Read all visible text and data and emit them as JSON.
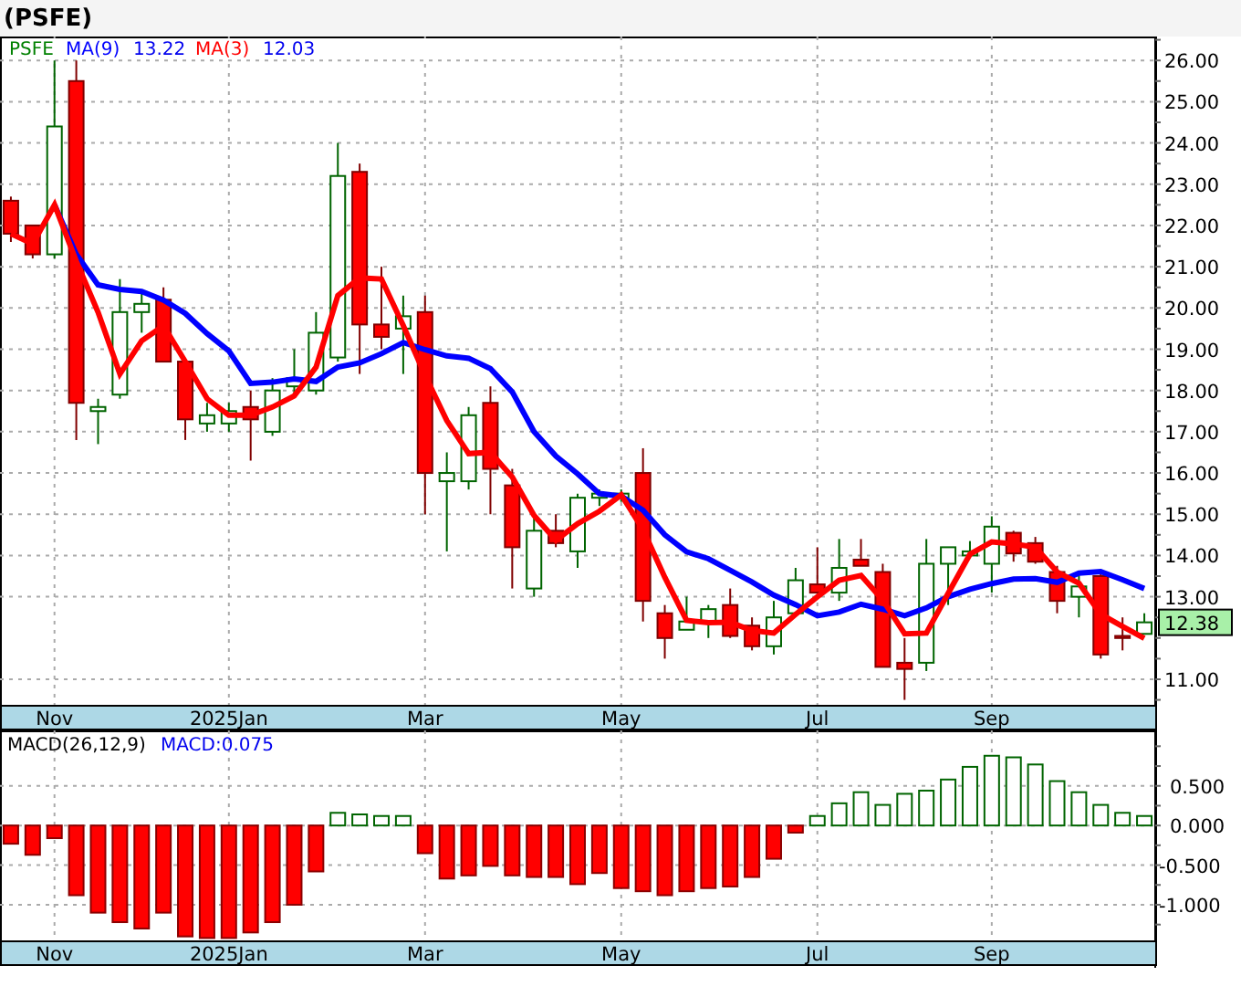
{
  "title": "(PSFE)",
  "price_panel": {
    "legend": {
      "symbol": "PSFE",
      "values": [
        "13.22",
        "12.03"
      ]
    },
    "last_price": "12.38",
    "chart_data": {
      "type": "candlestick",
      "grid": true,
      "ylim": [
        10.38,
        26.58
      ],
      "categories": [
        null,
        null,
        "Nov",
        null,
        null,
        null,
        null,
        null,
        null,
        null,
        "2025Jan",
        null,
        null,
        null,
        null,
        null,
        null,
        null,
        null,
        "Mar",
        null,
        null,
        null,
        null,
        null,
        null,
        null,
        null,
        "May",
        null,
        null,
        null,
        null,
        null,
        null,
        null,
        null,
        "Jul",
        null,
        null,
        null,
        null,
        null,
        null,
        null,
        "Sep",
        null,
        null,
        null,
        null,
        null,
        null,
        null
      ],
      "yticks": [
        {
          "value": 26,
          "label": "26.00"
        },
        {
          "value": 25,
          "label": "25.00"
        },
        {
          "value": 24,
          "label": "24.00"
        },
        {
          "value": 23,
          "label": "23.00"
        },
        {
          "value": 22,
          "label": "22.00"
        },
        {
          "value": 21,
          "label": "21.00"
        },
        {
          "value": 20,
          "label": "20.00"
        },
        {
          "value": 19,
          "label": "19.00"
        },
        {
          "value": 18,
          "label": "18.00"
        },
        {
          "value": 17,
          "label": "17.00"
        },
        {
          "value": 16,
          "label": "16.00"
        },
        {
          "value": 15,
          "label": "15.00"
        },
        {
          "value": 14,
          "label": "14.00"
        },
        {
          "value": 13,
          "label": "13.00"
        },
        {
          "value": 11,
          "label": "11.00"
        }
      ],
      "ohlc": [
        [
          22.6,
          22.7,
          21.6,
          21.8
        ],
        [
          22.0,
          22.0,
          21.2,
          21.3
        ],
        [
          21.3,
          26.0,
          21.2,
          24.4
        ],
        [
          25.5,
          26.0,
          16.8,
          17.7
        ],
        [
          17.5,
          17.8,
          16.7,
          17.6
        ],
        [
          17.9,
          20.7,
          17.8,
          19.9
        ],
        [
          19.9,
          20.4,
          19.4,
          20.1
        ],
        [
          20.2,
          20.5,
          18.7,
          18.7
        ],
        [
          18.7,
          18.7,
          16.8,
          17.3
        ],
        [
          17.2,
          17.7,
          17.0,
          17.4
        ],
        [
          17.2,
          17.7,
          17.0,
          17.5
        ],
        [
          17.6,
          18.0,
          16.3,
          17.3
        ],
        [
          17.0,
          18.3,
          16.9,
          18.0
        ],
        [
          18.1,
          19.0,
          17.9,
          18.3
        ],
        [
          18.0,
          19.9,
          17.9,
          19.4
        ],
        [
          18.8,
          24.0,
          18.7,
          23.2
        ],
        [
          23.3,
          23.5,
          18.4,
          19.6
        ],
        [
          19.6,
          21.0,
          19.0,
          19.3
        ],
        [
          19.5,
          20.3,
          18.4,
          19.8
        ],
        [
          19.9,
          20.3,
          15.0,
          16.0
        ],
        [
          15.8,
          16.5,
          14.1,
          16.0
        ],
        [
          15.8,
          17.6,
          15.6,
          17.4
        ],
        [
          17.7,
          18.1,
          15.0,
          16.1
        ],
        [
          15.7,
          16.1,
          13.2,
          14.2
        ],
        [
          13.2,
          15.0,
          13.0,
          14.6
        ],
        [
          14.6,
          15.0,
          14.2,
          14.3
        ],
        [
          14.1,
          15.5,
          13.7,
          15.4
        ],
        [
          15.4,
          15.6,
          15.2,
          15.5
        ],
        [
          15.4,
          15.6,
          15.3,
          15.5
        ],
        [
          16.0,
          16.6,
          12.4,
          12.9
        ],
        [
          12.6,
          12.8,
          11.5,
          12.0
        ],
        [
          12.2,
          13.0,
          12.2,
          12.4
        ],
        [
          12.4,
          12.8,
          12.0,
          12.7
        ],
        [
          12.8,
          13.2,
          12.0,
          12.05
        ],
        [
          12.3,
          12.5,
          11.7,
          11.8
        ],
        [
          11.8,
          12.9,
          11.6,
          12.5
        ],
        [
          12.6,
          13.7,
          12.6,
          13.4
        ],
        [
          13.3,
          14.2,
          13.1,
          13.1
        ],
        [
          13.1,
          14.4,
          12.9,
          13.7
        ],
        [
          13.9,
          14.4,
          13.75,
          13.75
        ],
        [
          13.6,
          13.8,
          11.3,
          11.3
        ],
        [
          11.4,
          12.0,
          10.5,
          11.25
        ],
        [
          11.4,
          14.4,
          11.2,
          13.8
        ],
        [
          13.8,
          14.2,
          12.8,
          14.2
        ],
        [
          14.0,
          14.35,
          14.0,
          14.1
        ],
        [
          13.8,
          14.95,
          13.1,
          14.7
        ],
        [
          14.55,
          14.6,
          13.85,
          14.05
        ],
        [
          14.3,
          14.45,
          13.8,
          13.85
        ],
        [
          13.6,
          13.75,
          12.6,
          12.9
        ],
        [
          13.0,
          13.6,
          12.5,
          13.25
        ],
        [
          13.5,
          13.55,
          11.5,
          11.6
        ],
        [
          12.05,
          12.5,
          11.7,
          12.0
        ],
        [
          12.1,
          12.6,
          12.1,
          12.38
        ]
      ],
      "series": [
        {
          "name": "MA(9)",
          "color": "#0000ff",
          "type": "line",
          "values": [
            null,
            null,
            22.5,
            21.3,
            20.56,
            20.45,
            20.4,
            20.19,
            19.87,
            19.38,
            18.96,
            18.17,
            18.2,
            18.28,
            18.22,
            18.57,
            18.67,
            18.89,
            19.16,
            18.99,
            18.84,
            18.78,
            18.53,
            17.96,
            17.0,
            16.41,
            15.98,
            15.5,
            15.44,
            15.1,
            14.5,
            14.09,
            13.92,
            13.64,
            13.36,
            13.04,
            12.81,
            12.54,
            12.63,
            12.82,
            12.7,
            12.54,
            12.73,
            13.0,
            13.18,
            13.32,
            13.43,
            13.44,
            13.35,
            13.57,
            13.61,
            13.41,
            13.2
          ]
        },
        {
          "name": "MA(3)",
          "color": "#ff0000",
          "type": "line",
          "values": [
            21.8,
            21.55,
            22.5,
            21.13,
            19.9,
            18.4,
            19.2,
            19.57,
            18.7,
            17.8,
            17.4,
            17.4,
            17.6,
            17.87,
            18.57,
            20.3,
            20.73,
            20.7,
            19.57,
            18.37,
            17.27,
            16.47,
            16.5,
            15.9,
            14.97,
            14.37,
            14.77,
            15.07,
            15.47,
            14.63,
            13.47,
            12.43,
            12.37,
            12.38,
            12.18,
            12.12,
            12.57,
            13.0,
            13.4,
            13.52,
            12.92,
            12.1,
            12.12,
            13.08,
            14.03,
            14.33,
            14.28,
            14.2,
            13.6,
            13.33,
            12.58,
            12.28,
            11.99
          ]
        }
      ]
    }
  },
  "macd_panel": {
    "legend": {
      "name": "MACD(26,12,9)",
      "value": "MACD:0.075"
    },
    "chart_data": {
      "type": "bar",
      "grid": true,
      "ylim": [
        -1.45,
        1.2
      ],
      "categories": [
        null,
        null,
        "Nov",
        null,
        null,
        null,
        null,
        null,
        null,
        null,
        "2025Jan",
        null,
        null,
        null,
        null,
        null,
        null,
        null,
        null,
        "Mar",
        null,
        null,
        null,
        null,
        null,
        null,
        null,
        null,
        "May",
        null,
        null,
        null,
        null,
        null,
        null,
        null,
        null,
        "Jul",
        null,
        null,
        null,
        null,
        null,
        null,
        null,
        "Sep",
        null,
        null,
        null,
        null,
        null,
        null,
        null
      ],
      "yticks": [
        {
          "value": 0.5,
          "label": "0.500"
        },
        {
          "value": 0,
          "label": "0.000"
        },
        {
          "value": -0.5,
          "label": "-0.500"
        },
        {
          "value": -1,
          "label": "-1.000"
        }
      ],
      "values": [
        -0.23,
        -0.37,
        -0.16,
        -0.88,
        -1.1,
        -1.22,
        -1.3,
        -1.1,
        -1.4,
        -1.42,
        -1.42,
        -1.35,
        -1.22,
        -1.0,
        -0.58,
        0.16,
        0.14,
        0.12,
        0.12,
        -0.35,
        -0.67,
        -0.63,
        -0.51,
        -0.63,
        -0.65,
        -0.65,
        -0.74,
        -0.6,
        -0.79,
        -0.83,
        -0.88,
        -0.83,
        -0.79,
        -0.77,
        -0.65,
        -0.42,
        -0.09,
        0.12,
        0.28,
        0.42,
        0.26,
        0.4,
        0.44,
        0.58,
        0.74,
        0.88,
        0.86,
        0.77,
        0.56,
        0.42,
        0.26,
        0.16,
        0.12
      ]
    }
  }
}
